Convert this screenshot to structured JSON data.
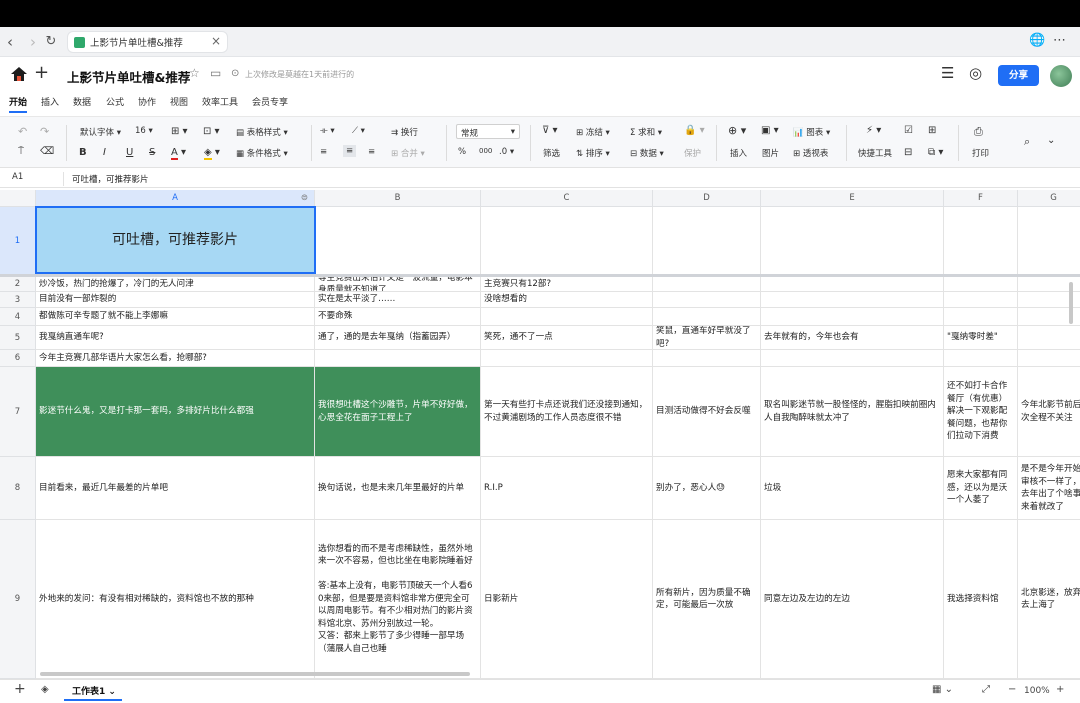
{
  "browser": {
    "tab_title": "上影节片单吐槽&推荐"
  },
  "header": {
    "title": "上影节片单吐槽&推荐",
    "last_modified": "上次修改是莫越在1天前进行的",
    "share_label": "分享"
  },
  "menu": [
    "开始",
    "插入",
    "数据",
    "公式",
    "协作",
    "视图",
    "效率工具",
    "会员专享"
  ],
  "toolbar": {
    "font": "默认字体",
    "size": "16",
    "table_style": "表格样式",
    "cond_format": "条件格式",
    "wrap": "换行",
    "merge": "合并",
    "number_format": "常规",
    "percent": "%",
    "thousands": "000",
    "decimal": ".0",
    "filter": "筛选",
    "freeze": "冻结",
    "sort": "排序",
    "sum": "求和",
    "data": "数据",
    "protect": "保护",
    "insert": "插入",
    "image": "图片",
    "chart": "图表",
    "pivot": "透视表",
    "quick_tools": "快捷工具",
    "print": "打印"
  },
  "formula_bar": {
    "cell_ref": "A1",
    "value": "可吐槽，可推荐影片"
  },
  "columns": [
    "A",
    "B",
    "C",
    "D",
    "E",
    "F",
    "G"
  ],
  "rows": [
    {
      "num": "1",
      "cells": [
        "可吐槽，可推荐影片",
        "",
        "",
        "",
        "",
        "",
        ""
      ]
    },
    {
      "num": "2",
      "cells": [
        "炒冷饭，热门的抢爆了，冷门的无人问津",
        "等主竞赛出来估计又是一波流量，电影本身质量就不知道了",
        "主竞赛只有12部?",
        "",
        "",
        "",
        ""
      ]
    },
    {
      "num": "3",
      "cells": [
        "目前没有一部炸裂的",
        "实在是太平淡了……",
        "没啥想看的",
        "",
        "",
        "",
        ""
      ]
    },
    {
      "num": "4",
      "cells": [
        "都做陈可辛专题了就不能上李娜嘛",
        "不要命殊",
        "",
        "",
        "",
        "",
        ""
      ]
    },
    {
      "num": "5",
      "cells": [
        "我戛纳直通车呢?",
        "通了，通的是去年戛纳（指蓄园弄）",
        "笑死，通不了一点",
        "笑鼠，直通车好早就没了吧?",
        "去年就有的，今年也会有",
        "\"戛纳零时差\"",
        ""
      ]
    },
    {
      "num": "6",
      "cells": [
        "今年主竞赛几部华语片大家怎么看，抢哪部?",
        "",
        "",
        "",
        "",
        "",
        ""
      ]
    },
    {
      "num": "7",
      "cells": [
        "影迷节什么鬼，又是打卡那一套吗，多排好片比什么都强",
        "我很想吐槽这个沙雕节，片单不好好做，心思全花在面子工程上了",
        "第一天有些打卡点还说我们还没接到通知，不过黄浦剧场的工作人员态度很不错",
        "目测活动做得不好会反噬",
        "取名叫影迷节就一股怪怪的，腥脂扣映前圈内人自我陶醉味就太冲了",
        "还不如打卡合作餐厅（有优惠）解决一下观影配餐问题，也帮你们拉动下消费",
        "今年北影节前后次全程不关注"
      ]
    },
    {
      "num": "8",
      "cells": [
        "目前看来，最近几年最差的片单吧",
        "换句话说，也是未来几年里最好的片单",
        "R.I.P",
        "别办了，恶心人😓",
        "垃圾",
        "愿来大家都有同感，还以为是沃一个人萎了",
        "是不是今年开始审核不一样了，去年出了个啥事来着就改了"
      ]
    },
    {
      "num": "9",
      "cells": [
        "外地来的发问：有没有相对稀缺的，资料馆也不放的那种",
        "选你想看的而不是考虑稀缺性，虽然外地来一次不容易，但也比坐在电影院睡着好\n\n答:基本上没有，电影节顶破天一个人看60来部，但是要是资料馆非常方便完全可以周周电影节。有不少相对热门的影片资料馆北京、苏州分别放过一轮。\n又答：都来上影节了多少得睡一部早场（蒲展人自己也睡",
        "日影新片",
        "所有新片，因为质量不确定，可能最后一次放",
        "同意左边及左边的左边",
        "我选择资料馆",
        "北京影迷，放弃去上海了"
      ]
    }
  ],
  "bottom": {
    "sheet_name": "工作表1",
    "zoom": "100%"
  }
}
